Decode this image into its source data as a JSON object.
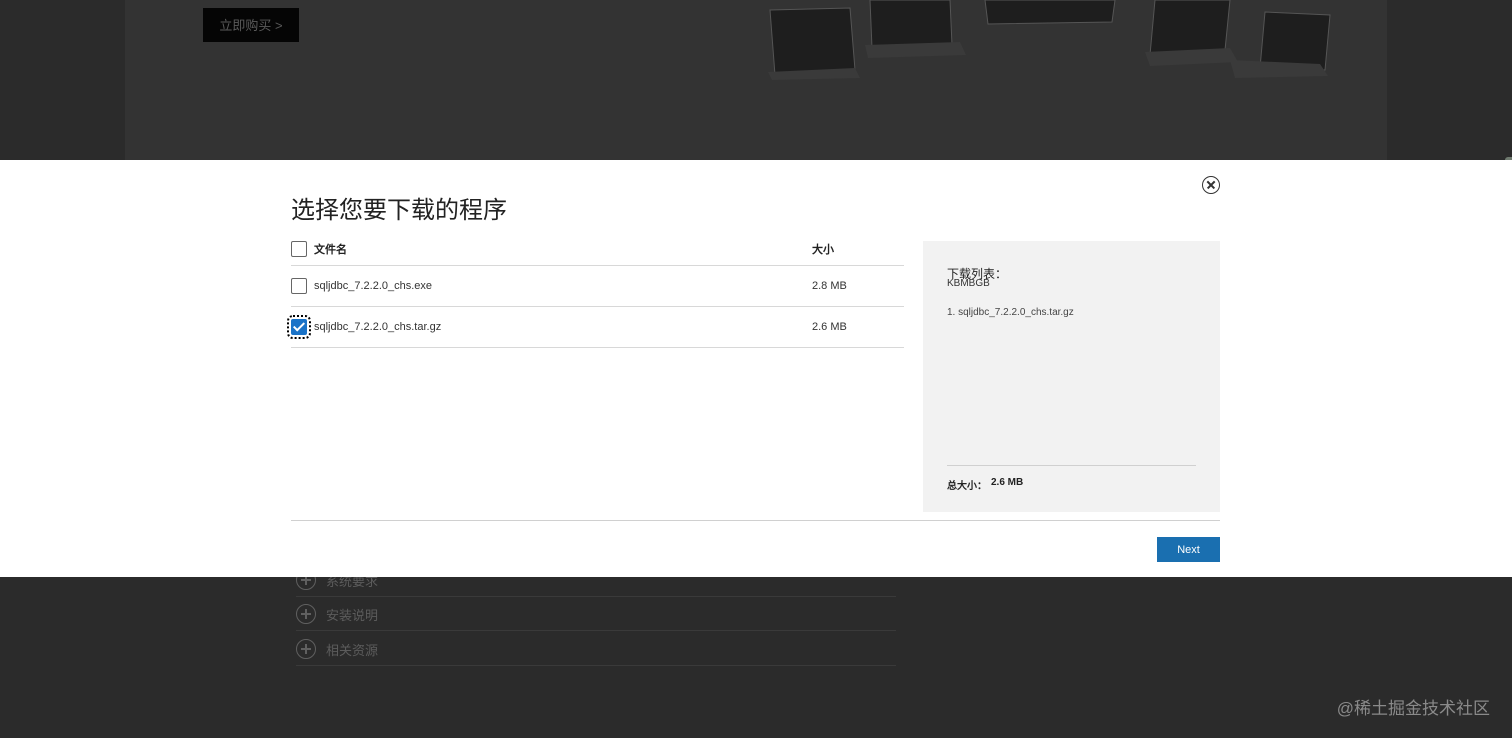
{
  "background": {
    "buy_button_label": "立即购买 >",
    "accordion": [
      {
        "label": "系统要求"
      },
      {
        "label": "安装说明"
      },
      {
        "label": "相关资源"
      }
    ],
    "watermark": "@稀土掘金技术社区"
  },
  "modal": {
    "title": "选择您要下载的程序",
    "table": {
      "header_name": "文件名",
      "header_size": "大小",
      "rows": [
        {
          "name": "sqljdbc_7.2.2.0_chs.exe",
          "size": "2.8 MB",
          "checked": false
        },
        {
          "name": "sqljdbc_7.2.2.0_chs.tar.gz",
          "size": "2.6 MB",
          "checked": true
        }
      ]
    },
    "download_list": {
      "title": "下载列表：",
      "unit": "KBMBGB",
      "items": [
        "1. sqljdbc_7.2.2.0_chs.tar.gz"
      ],
      "total_label": "总大小：",
      "total_value": "2.6 MB"
    },
    "next_label": "Next"
  },
  "colors": {
    "accent": "#1a6fb0",
    "overlay": "#2b2b2b",
    "panel": "#f2f2f2"
  }
}
